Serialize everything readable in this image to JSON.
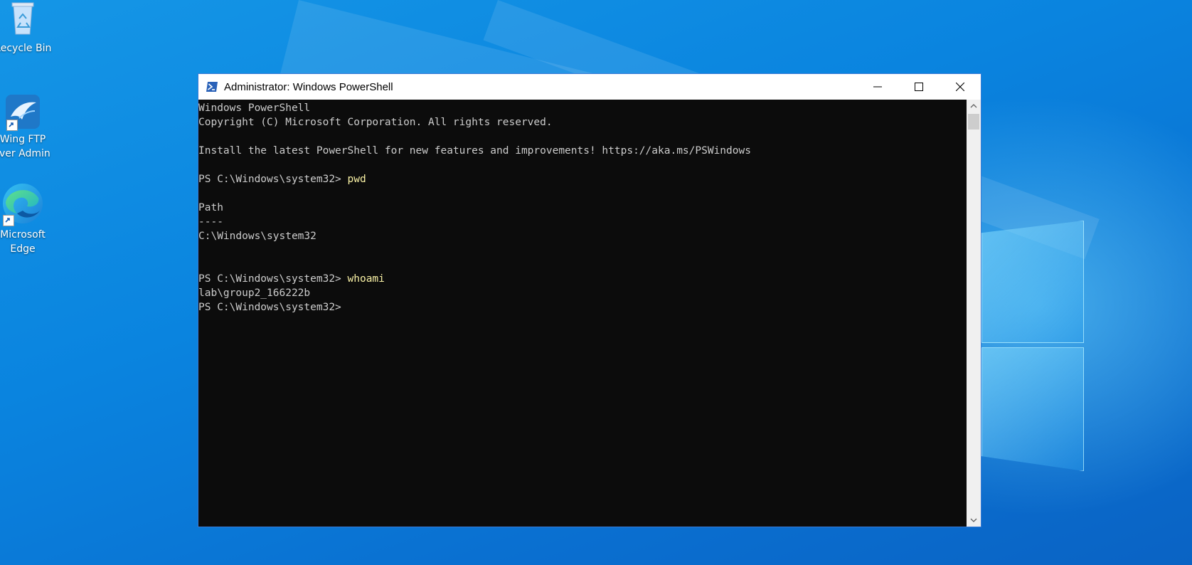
{
  "desktop": {
    "icons": [
      {
        "label_lines": [
          "Recycle Bin"
        ],
        "icon": "recycle-bin-icon"
      },
      {
        "label_lines": [
          "Wing FTP",
          "rver Admin"
        ],
        "icon": "wing-ftp-icon"
      },
      {
        "label_lines": [
          "Microsoft",
          "Edge"
        ],
        "icon": "edge-icon"
      }
    ]
  },
  "window": {
    "title": "Administrator: Windows PowerShell",
    "icon": "powershell-icon",
    "controls": [
      "minimize-icon",
      "maximize-icon",
      "close-icon"
    ]
  },
  "console": {
    "lines": [
      {
        "prompt": "Windows PowerShell",
        "command": ""
      },
      {
        "prompt": "Copyright (C) Microsoft Corporation. All rights reserved.",
        "command": ""
      },
      {
        "prompt": "",
        "command": ""
      },
      {
        "prompt": "Install the latest PowerShell for new features and improvements! https://aka.ms/PSWindows",
        "command": ""
      },
      {
        "prompt": "",
        "command": ""
      },
      {
        "prompt": "PS C:\\Windows\\system32> ",
        "command": "pwd"
      },
      {
        "prompt": "",
        "command": ""
      },
      {
        "prompt": "Path",
        "command": ""
      },
      {
        "prompt": "----",
        "command": ""
      },
      {
        "prompt": "C:\\Windows\\system32",
        "command": ""
      },
      {
        "prompt": "",
        "command": ""
      },
      {
        "prompt": "",
        "command": ""
      },
      {
        "prompt": "PS C:\\Windows\\system32> ",
        "command": "whoami"
      },
      {
        "prompt": "lab\\group2_166222b",
        "command": ""
      },
      {
        "prompt": "PS C:\\Windows\\system32>",
        "command": ""
      }
    ]
  },
  "colors": {
    "console_bg": "#0c0c0c",
    "console_text": "#cccccc",
    "command_text": "#f9f1a5",
    "desktop": "#0a84df"
  }
}
